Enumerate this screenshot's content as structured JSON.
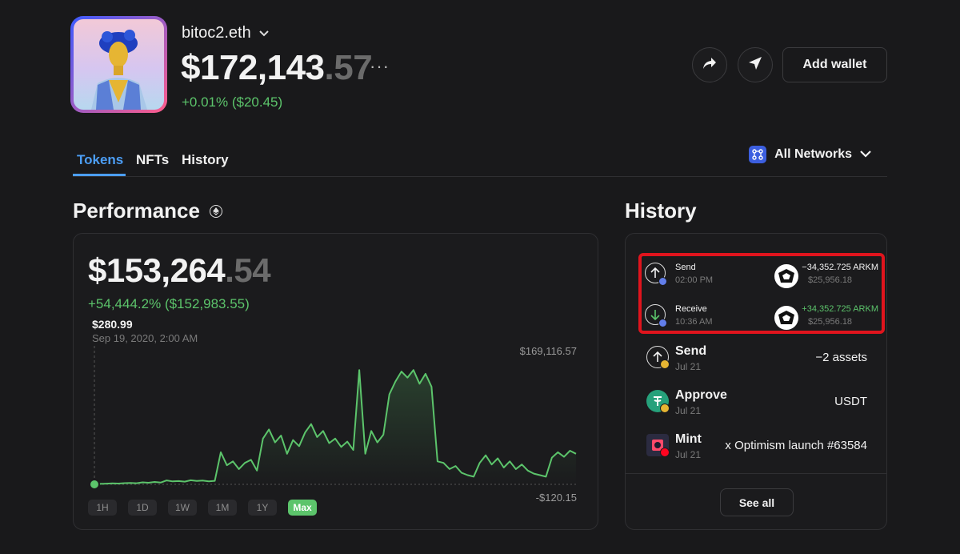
{
  "header": {
    "wallet_name": "bitoc2.eth",
    "balance_main": "$172,143",
    "balance_cents": ".57",
    "more": "···",
    "change": "+0.01% ($20.45)",
    "add_wallet": "Add wallet"
  },
  "tabs": [
    {
      "label": "Tokens",
      "active": true
    },
    {
      "label": "NFTs",
      "active": false
    },
    {
      "label": "History",
      "active": false
    }
  ],
  "networks": {
    "label": "All Networks"
  },
  "performance": {
    "title": "Performance",
    "value_main": "$153,264",
    "value_cents": ".54",
    "change": "+54,444.2% ($152,983.55)",
    "point_value": "$280.99",
    "point_date": "Sep 19, 2020, 2:00 AM",
    "max_label": "$169,116.57",
    "min_label": "-$120.15",
    "ranges": [
      "1H",
      "1D",
      "1W",
      "1M",
      "1Y",
      "Max"
    ],
    "active_range": "Max",
    "line_color": "#5cc46b"
  },
  "history": {
    "title": "History",
    "highlighted": [
      {
        "type": "Send",
        "time": "02:00 PM",
        "amount": "−34,352.725 ARKM",
        "usd": "$25,956.18",
        "positive": false
      },
      {
        "type": "Receive",
        "time": "10:36 AM",
        "amount": "+34,352.725 ARKM",
        "usd": "$25,956.18",
        "positive": true
      }
    ],
    "items": [
      {
        "type": "Send",
        "date": "Jul 21",
        "value": "−2 assets"
      },
      {
        "type": "Approve",
        "date": "Jul 21",
        "value": "USDT"
      },
      {
        "type": "Mint",
        "date": "Jul 21",
        "value": "x Optimism launch #63584"
      }
    ],
    "see_all": "See all"
  },
  "chart_data": {
    "type": "line",
    "title": "",
    "xlabel": "",
    "ylabel": "",
    "ylim": [
      -120.15,
      169116.57
    ],
    "x": [
      "Sep 2020",
      "",
      "",
      "",
      "",
      "",
      "",
      "",
      "",
      "",
      "",
      "",
      "",
      "",
      "",
      "",
      "",
      "",
      "",
      "",
      "",
      "",
      "",
      "",
      "",
      "",
      "",
      "",
      "",
      "",
      "",
      "",
      "",
      "",
      "",
      "",
      "",
      "",
      "",
      "",
      "",
      "",
      "",
      "",
      "",
      "",
      "",
      "",
      "",
      "",
      "",
      "",
      "",
      "",
      "",
      "",
      "",
      "",
      "",
      "",
      "",
      "",
      "",
      "",
      "",
      "",
      "",
      "",
      "",
      "",
      "",
      "",
      "",
      "",
      "",
      "",
      "",
      "",
      "",
      "",
      ""
    ],
    "series": [
      {
        "values": [
          281,
          500,
          800,
          1200,
          900,
          1500,
          1800,
          1300,
          2500,
          2000,
          3000,
          2200,
          5000,
          3800,
          4200,
          3500,
          5200,
          4300,
          4800,
          3900,
          4500,
          42000,
          25000,
          30000,
          20000,
          28000,
          32000,
          18000,
          60000,
          72000,
          55000,
          64000,
          40000,
          58000,
          50000,
          68000,
          79000,
          62000,
          70000,
          54000,
          60000,
          49000,
          56000,
          45000,
          150000,
          40000,
          70000,
          55000,
          65000,
          118000,
          135000,
          148000,
          140000,
          150000,
          132000,
          145000,
          128000,
          30000,
          28000,
          20000,
          24000,
          15000,
          12000,
          10000,
          28000,
          38000,
          26000,
          34000,
          22000,
          30000,
          20000,
          26000,
          18000,
          14000,
          12000,
          10000,
          35000,
          42000,
          36000,
          44000,
          40000
        ]
      }
    ]
  }
}
